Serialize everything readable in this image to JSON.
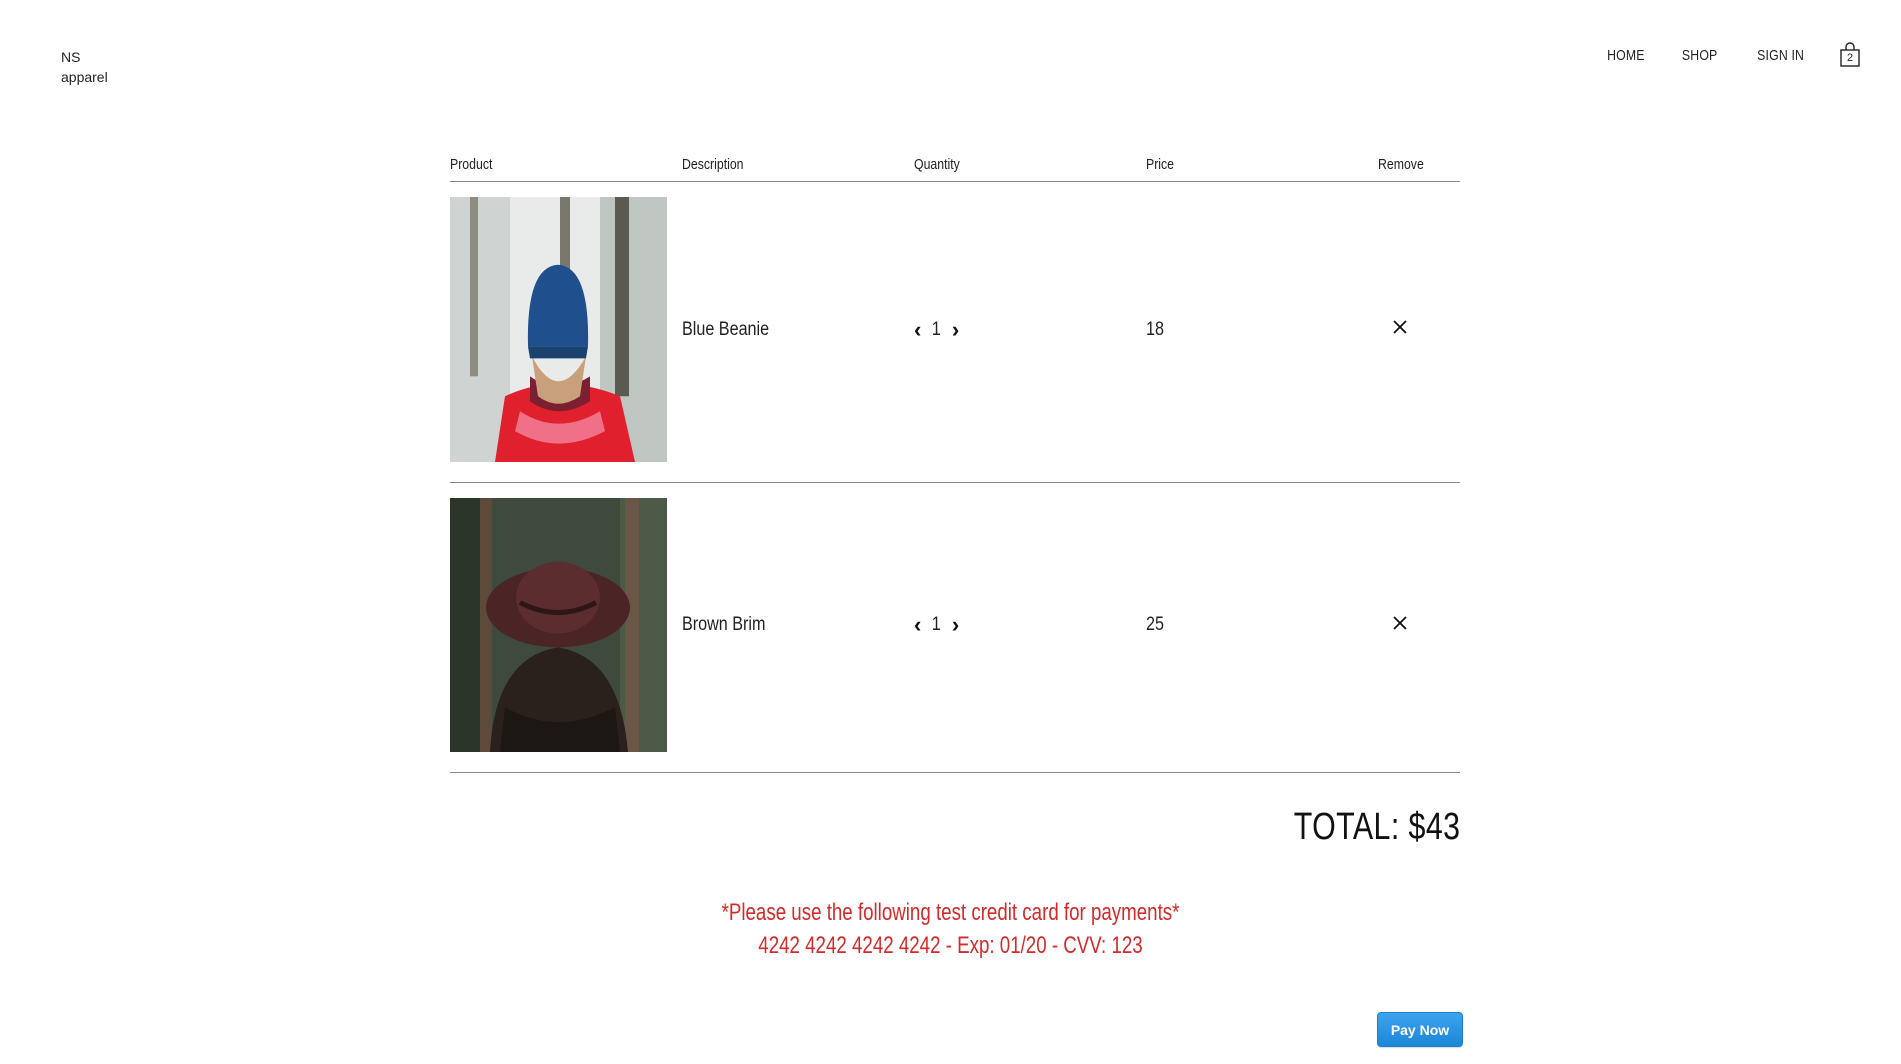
{
  "brand": {
    "line1": "NS",
    "line2": "apparel"
  },
  "nav": {
    "home": "HOME",
    "shop": "SHOP",
    "sign_in": "SIGN IN",
    "cart_count": "2"
  },
  "table": {
    "headers": [
      "Product",
      "Description",
      "Quantity",
      "Price",
      "Remove"
    ],
    "rows": [
      {
        "description": "Blue Beanie",
        "quantity": "1",
        "price": "18",
        "image": "woman-blue-beanie-red-jacket-snow"
      },
      {
        "description": "Brown Brim",
        "quantity": "1",
        "price": "25",
        "image": "woman-brown-brim-hat-forest"
      }
    ]
  },
  "total": "TOTAL: $43",
  "notice": {
    "line1": "*Please use the following test credit card for payments*",
    "line2": "4242 4242 4242 4242 - Exp: 01/20 - CVV: 123"
  },
  "pay_button": "Pay Now",
  "colors": {
    "notice": "#d42a2a",
    "pay_button": "#2b95e3",
    "divider": "#8a8a8a"
  }
}
